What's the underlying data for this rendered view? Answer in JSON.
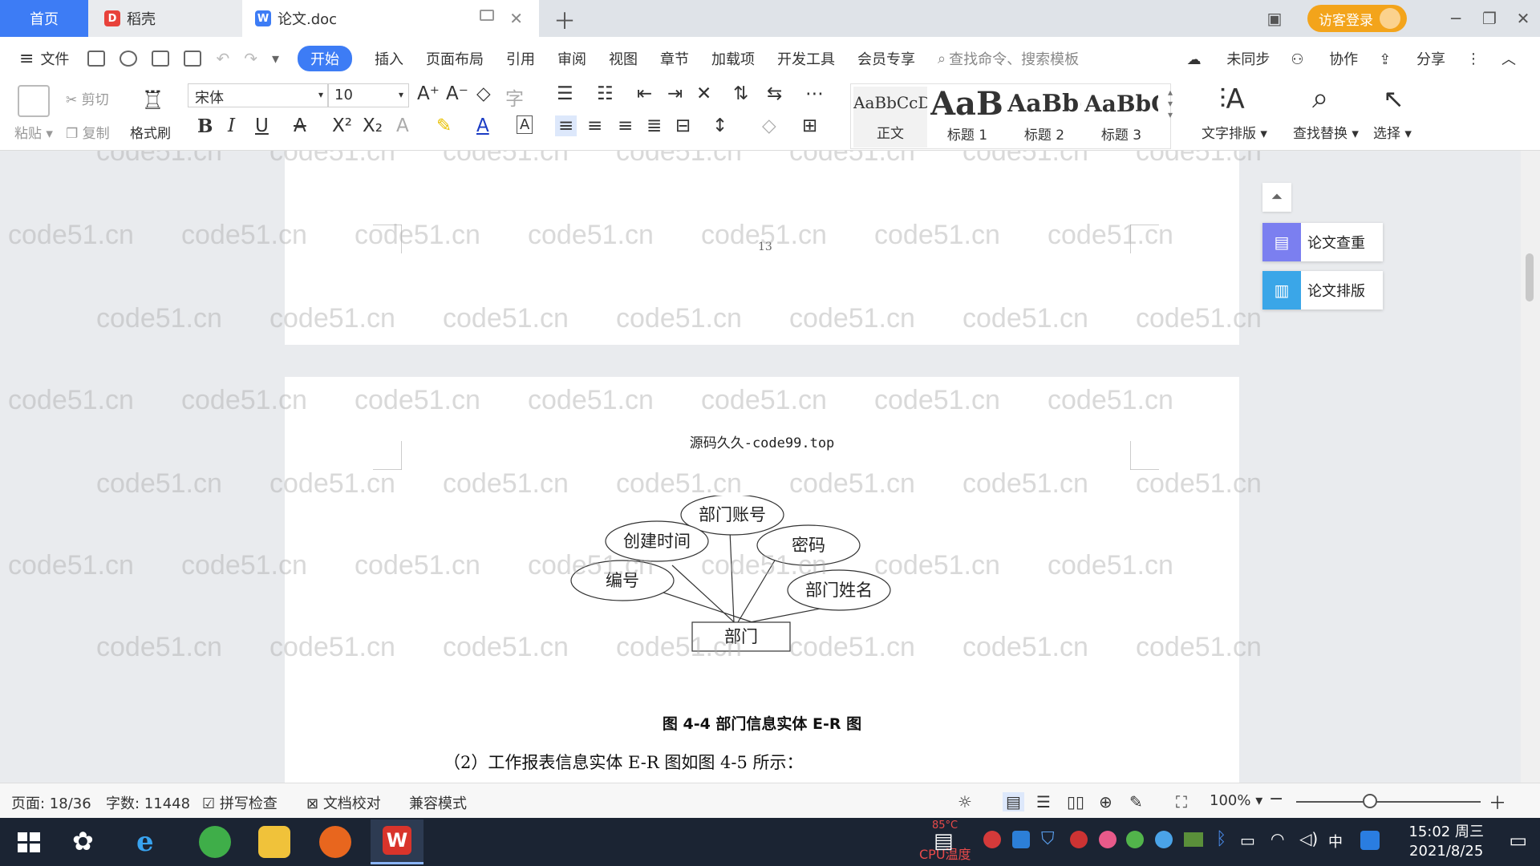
{
  "tabs": {
    "home": "首页",
    "docer": "稻壳",
    "document": "论文.doc"
  },
  "tabbar": {
    "login": "访客登录"
  },
  "menu": {
    "file": "文件",
    "items": [
      "开始",
      "插入",
      "页面布局",
      "引用",
      "审阅",
      "视图",
      "章节",
      "加载项",
      "开发工具",
      "会员专享"
    ],
    "search": "查找命令、搜索模板",
    "sync": "未同步",
    "collab": "协作",
    "share": "分享"
  },
  "ribbon": {
    "paste": "粘贴",
    "cut": "剪切",
    "copy": "复制",
    "format_painter": "格式刷",
    "font_name": "宋体",
    "font_size": "10",
    "styles": [
      {
        "preview": "AaBbCcDd",
        "label": "正文"
      },
      {
        "preview": "AaBl",
        "label": "标题 1"
      },
      {
        "preview": "AaBb(",
        "label": "标题 2"
      },
      {
        "preview": "AaBbC",
        "label": "标题 3"
      }
    ],
    "text_layout": "文字排版",
    "find_replace": "查找替换",
    "select": "选择"
  },
  "document": {
    "page_number": "13",
    "header": "源码久久-code99.top",
    "figure_caption": "图 4-4  部门信息实体 E-R 图",
    "body_text": "（2）工作报表信息实体 E-R 图如图 4-5 所示：",
    "er_diagram": {
      "entity": "部门",
      "attributes": [
        "部门账号",
        "创建时间",
        "密码",
        "编号",
        "部门姓名"
      ]
    },
    "watermark": "code51.cn"
  },
  "side_panel": {
    "check": "论文查重",
    "layout": "论文排版"
  },
  "status": {
    "page": "页面: 18/36",
    "words": "字数: 11448",
    "spell": "拼写检查",
    "proof": "文档校对",
    "compat": "兼容模式",
    "zoom": "100%",
    "zoom_level": 0.4
  },
  "taskbar": {
    "cpu_temp": "85°C",
    "cpu_label": "CPU温度",
    "ime": "中",
    "time": "15:02 周三",
    "date": "2021/8/25"
  },
  "colors": {
    "accent": "#3d7cf5",
    "login": "#f3a41b",
    "check_icon": "#7b7ff0",
    "layout_icon": "#3aa6e8"
  }
}
